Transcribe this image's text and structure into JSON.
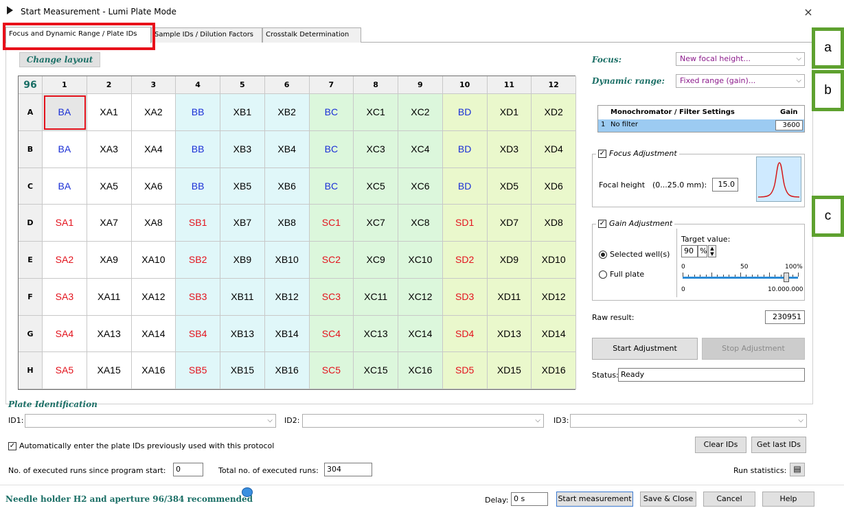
{
  "window": {
    "title": "Start Measurement - Lumi Plate Mode",
    "close_glyph": "×"
  },
  "tabs": [
    {
      "label": "Focus and Dynamic Range / Plate IDs",
      "active": true
    },
    {
      "label": "Sample IDs / Dilution Factors",
      "active": false
    },
    {
      "label": "Crosstalk Determination",
      "active": false
    }
  ],
  "plate": {
    "change_layout_label": "Change layout",
    "corner_label": "96",
    "columns": [
      "1",
      "2",
      "3",
      "4",
      "5",
      "6",
      "7",
      "8",
      "9",
      "10",
      "11",
      "12"
    ],
    "rows": [
      {
        "label": "A",
        "wells": [
          "BA",
          "XA1",
          "XA2",
          "BB",
          "XB1",
          "XB2",
          "BC",
          "XC1",
          "XC2",
          "BD",
          "XD1",
          "XD2"
        ]
      },
      {
        "label": "B",
        "wells": [
          "BA",
          "XA3",
          "XA4",
          "BB",
          "XB3",
          "XB4",
          "BC",
          "XC3",
          "XC4",
          "BD",
          "XD3",
          "XD4"
        ]
      },
      {
        "label": "C",
        "wells": [
          "BA",
          "XA5",
          "XA6",
          "BB",
          "XB5",
          "XB6",
          "BC",
          "XC5",
          "XC6",
          "BD",
          "XD5",
          "XD6"
        ]
      },
      {
        "label": "D",
        "wells": [
          "SA1",
          "XA7",
          "XA8",
          "SB1",
          "XB7",
          "XB8",
          "SC1",
          "XC7",
          "XC8",
          "SD1",
          "XD7",
          "XD8"
        ]
      },
      {
        "label": "E",
        "wells": [
          "SA2",
          "XA9",
          "XA10",
          "SB2",
          "XB9",
          "XB10",
          "SC2",
          "XC9",
          "XC10",
          "SD2",
          "XD9",
          "XD10"
        ]
      },
      {
        "label": "F",
        "wells": [
          "SA3",
          "XA11",
          "XA12",
          "SB3",
          "XB11",
          "XB12",
          "SC3",
          "XC11",
          "XC12",
          "SD3",
          "XD11",
          "XD12"
        ]
      },
      {
        "label": "G",
        "wells": [
          "SA4",
          "XA13",
          "XA14",
          "SB4",
          "XB13",
          "XB14",
          "SC4",
          "XC13",
          "XC14",
          "SD4",
          "XD13",
          "XD14"
        ]
      },
      {
        "label": "H",
        "wells": [
          "SA5",
          "XA15",
          "XA16",
          "SB5",
          "XB15",
          "XB16",
          "SC5",
          "XC15",
          "XC16",
          "SD5",
          "XD15",
          "XD16"
        ]
      }
    ],
    "column_colors": [
      "#ffffff",
      "#ffffff",
      "#ffffff",
      "#e0f7f9",
      "#e0f7f9",
      "#e0f7f9",
      "#dcf7dc",
      "#dcf7dc",
      "#dcf7dc",
      "#eaf8cc",
      "#eaf8cc",
      "#eaf8cc"
    ],
    "text_colors": {
      "blank": "#1a2fd6",
      "standard": "#e3121c",
      "sample": "#000000"
    }
  },
  "settings": {
    "focus_label": "Focus:",
    "focus_value": "New focal height...",
    "dynamic_label": "Dynamic range:",
    "dynamic_value": "Fixed range (gain)...",
    "filter_table": {
      "col_settings": "Monochromator / Filter Settings",
      "col_gain": "Gain",
      "row_index": "1",
      "row_name": "No filter",
      "row_gain": "3600"
    },
    "focus_adjust": {
      "legend": "Focus Adjustment",
      "height_label": "Focal height",
      "range_label": "(0...25.0 mm):",
      "height_value": "15.0"
    },
    "gain_adjust": {
      "legend": "Gain Adjustment",
      "selected_label": "Selected well(s)",
      "full_label": "Full plate",
      "target_label": "Target value:",
      "target_value": "90",
      "target_unit": "%",
      "scale_0": "0",
      "scale_50": "50",
      "scale_100": "100%",
      "scale_bottom_0": "0",
      "scale_bottom_max": "10.000.000",
      "slider_level_percent": 90
    },
    "raw_result_label": "Raw result:",
    "raw_result_value": "230951",
    "start_adjust_label": "Start Adjustment",
    "stop_adjust_label": "Stop Adjustment",
    "status_label": "Status:",
    "status_value": "Ready"
  },
  "annotations": [
    "a",
    "b",
    "c"
  ],
  "plate_id": {
    "section_title": "Plate Identification",
    "id1_label": "ID1:",
    "id2_label": "ID2:",
    "id3_label": "ID3:",
    "auto_label": "Automatically enter the plate IDs previously used with this protocol",
    "clear_label": "Clear IDs",
    "last_label": "Get last IDs",
    "runs_label": "No. of executed runs since program start:",
    "runs_value": "0",
    "total_label": "Total no. of executed runs:",
    "total_value": "304",
    "stats_label": "Run statistics:"
  },
  "footer": {
    "hint": "Needle holder H2 and aperture 96/384 recommended",
    "delay_label": "Delay:",
    "delay_value": "0 s",
    "start_label": "Start measurement",
    "save_label": "Save & Close",
    "cancel_label": "Cancel",
    "help_label": "Help"
  }
}
